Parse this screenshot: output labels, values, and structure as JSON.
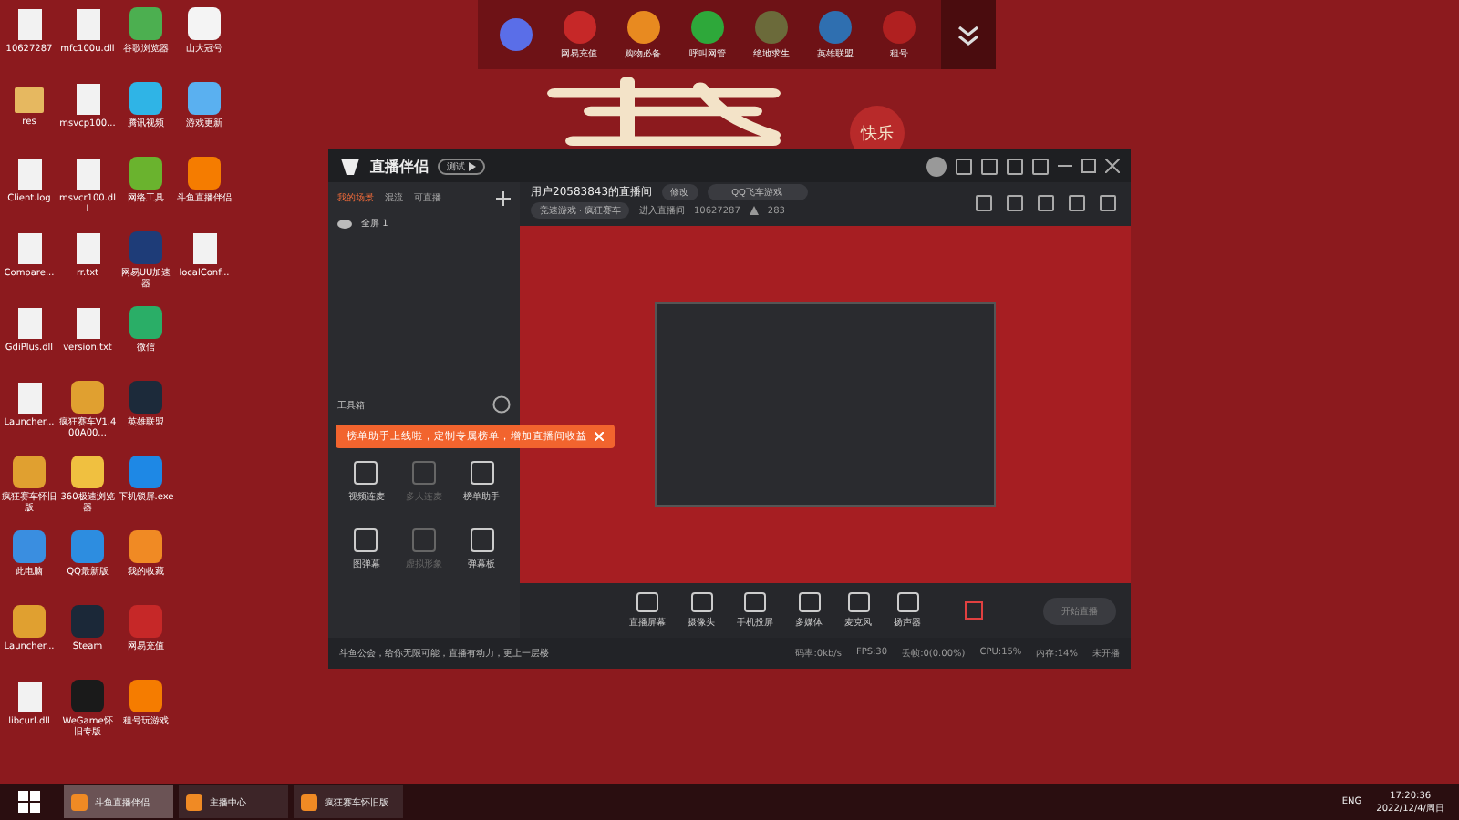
{
  "desktop_icons": [
    {
      "label": "10627287",
      "kind": "file"
    },
    {
      "label": "res",
      "kind": "folder"
    },
    {
      "label": "Client.log",
      "kind": "file"
    },
    {
      "label": "Compare...",
      "kind": "file"
    },
    {
      "label": "GdiPlus.dll",
      "kind": "file"
    },
    {
      "label": "Launcher...",
      "kind": "file"
    },
    {
      "label": "疯狂赛车怀旧版",
      "kind": "app",
      "color": "#e0a030"
    },
    {
      "label": "此电脑",
      "kind": "app",
      "color": "#3a8ee0"
    },
    {
      "label": "Launcher...",
      "kind": "app",
      "color": "#e0a030"
    },
    {
      "label": "libcurl.dll",
      "kind": "file"
    },
    {
      "label": "mfc100u.dll",
      "kind": "file"
    },
    {
      "label": "msvcp100...",
      "kind": "file"
    },
    {
      "label": "msvcr100.dll",
      "kind": "file"
    },
    {
      "label": "rr.txt",
      "kind": "file"
    },
    {
      "label": "version.txt",
      "kind": "file"
    },
    {
      "label": "疯狂赛车V1.400A00...",
      "kind": "app",
      "color": "#e0a030"
    },
    {
      "label": "360极速浏览器",
      "kind": "app",
      "color": "#f0c040"
    },
    {
      "label": "QQ最新版",
      "kind": "app",
      "color": "#2d8de0"
    },
    {
      "label": "Steam",
      "kind": "app",
      "color": "#1b2838"
    },
    {
      "label": "WeGame怀旧专版",
      "kind": "app",
      "color": "#1a1a1a"
    },
    {
      "label": "谷歌浏览器",
      "kind": "app",
      "color": "#4caf50"
    },
    {
      "label": "腾讯视频",
      "kind": "app",
      "color": "#2fb4e6"
    },
    {
      "label": "网络工具",
      "kind": "app",
      "color": "#6ab32e"
    },
    {
      "label": "网易UU加速器",
      "kind": "app",
      "color": "#1e3c78"
    },
    {
      "label": "微信",
      "kind": "app",
      "color": "#2aae67"
    },
    {
      "label": "英雄联盟",
      "kind": "app",
      "color": "#1c2a3a"
    },
    {
      "label": "下机锁屏.exe",
      "kind": "app",
      "color": "#1e88e5"
    },
    {
      "label": "我的收藏",
      "kind": "app",
      "color": "#f08a24"
    },
    {
      "label": "网易充值",
      "kind": "app",
      "color": "#c62828"
    },
    {
      "label": "租号玩游戏",
      "kind": "app",
      "color": "#f57c00"
    },
    {
      "label": "山大冠号",
      "kind": "app",
      "color": "#f4f4f4"
    },
    {
      "label": "游戏更新",
      "kind": "app",
      "color": "#5ab0f0"
    },
    {
      "label": "斗鱼直播伴侣",
      "kind": "app",
      "color": "#f57c00"
    },
    {
      "label": "localConf...",
      "kind": "file"
    }
  ],
  "dock": {
    "items": [
      {
        "color": "#5a6ee8"
      },
      {
        "label": "网易充值",
        "color": "#c62828"
      },
      {
        "label": "购物必备",
        "color": "#e88a20"
      },
      {
        "label": "呼叫网管",
        "color": "#2ea83a"
      },
      {
        "label": "绝地求生",
        "color": "#6b6a3a"
      },
      {
        "label": "英雄联盟",
        "color": "#2f6fb0"
      },
      {
        "label": "租号",
        "color": "#b02020"
      }
    ]
  },
  "decoration": {
    "badge": "快乐"
  },
  "app": {
    "title": "直播伴侣",
    "version": "测试",
    "scene_tabs": [
      {
        "label": "我的场景",
        "selected": true
      },
      {
        "label": "混流",
        "selected": false
      },
      {
        "label": "可直播",
        "selected": false
      }
    ],
    "scenes": [
      {
        "label": "全屏 1"
      }
    ],
    "toolbox_title": "工具箱",
    "tools": [
      {
        "label": "视频连麦",
        "disabled": false
      },
      {
        "label": "多人连麦",
        "disabled": true
      },
      {
        "label": "榜单助手",
        "disabled": false
      },
      {
        "label": "图弹幕",
        "disabled": false
      },
      {
        "label": "虚拟形象",
        "disabled": true
      },
      {
        "label": "弹幕板",
        "disabled": false
      }
    ],
    "tooltip": "榜单助手上线啦，定制专属榜单，增加直播间收益",
    "notice": "斗鱼公会，给你无限可能，直播有动力，更上一层楼",
    "room": {
      "name": "用户20583843的直播间",
      "edit": "修改",
      "game": "QQ飞车游戏",
      "category": "竞速游戏 · 疯狂赛车",
      "enter": "进入直播间",
      "room_id": "10627287",
      "hot": "283"
    },
    "controls": [
      {
        "label": "直播屏幕"
      },
      {
        "label": "摄像头"
      },
      {
        "label": "手机投屏"
      },
      {
        "label": "多媒体"
      },
      {
        "label": "麦克风"
      },
      {
        "label": "扬声器"
      }
    ],
    "start_button": "开始直播",
    "status": [
      "码率:0kb/s",
      "FPS:30",
      "丢帧:0(0.00%)",
      "CPU:15%",
      "内存:14%",
      "未开播"
    ]
  },
  "taskbar": {
    "items": [
      {
        "label": "斗鱼直播伴侣",
        "selected": true
      },
      {
        "label": "主播中心",
        "selected": false
      },
      {
        "label": "疯狂赛车怀旧版",
        "selected": false
      }
    ],
    "lang": "ENG",
    "time": "17:20:36",
    "date": "2022/12/4/周日"
  }
}
